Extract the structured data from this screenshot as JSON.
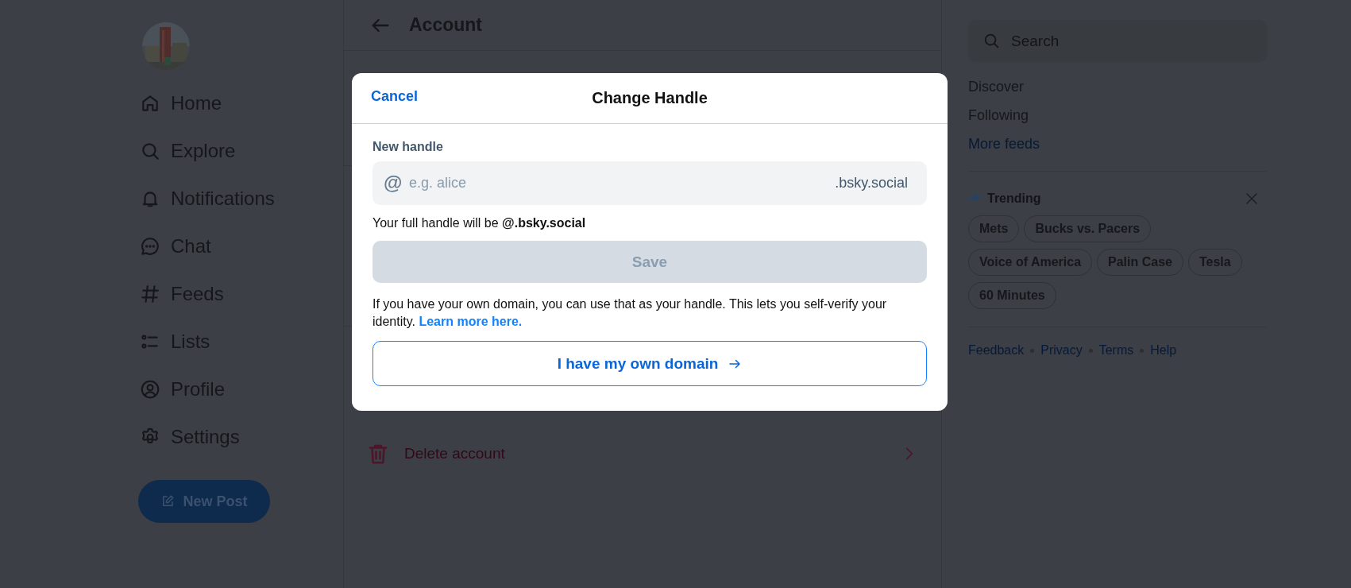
{
  "sidebar": {
    "nav": [
      {
        "label": "Home"
      },
      {
        "label": "Explore"
      },
      {
        "label": "Notifications"
      },
      {
        "label": "Chat"
      },
      {
        "label": "Feeds"
      },
      {
        "label": "Lists"
      },
      {
        "label": "Profile"
      },
      {
        "label": "Settings"
      }
    ],
    "new_post": "New Post"
  },
  "main": {
    "title": "Account",
    "rows": [
      {
        "label": "Delete account",
        "kind": "danger"
      }
    ]
  },
  "right": {
    "search": {
      "placeholder": "Search"
    },
    "feeds": [
      {
        "label": "Discover",
        "kind": "plain"
      },
      {
        "label": "Following",
        "kind": "plain"
      },
      {
        "label": "More feeds",
        "kind": "link"
      }
    ],
    "trending": {
      "title": "Trending",
      "topics": [
        "Mets",
        "Bucks vs. Pacers",
        "Voice of America",
        "Palin Case",
        "Tesla",
        "60 Minutes"
      ]
    },
    "footer": [
      "Feedback",
      "Privacy",
      "Terms",
      "Help"
    ]
  },
  "dialog": {
    "cancel": "Cancel",
    "title": "Change Handle",
    "field_label": "New handle",
    "prefix": "@",
    "placeholder": "e.g. alice",
    "suffix": ".bsky.social",
    "preview": "Your full handle will be **@.bsky.social**",
    "save": {
      "label": "Save",
      "disabled": true
    },
    "info": "If you have your own domain, you can use that as your handle. This lets you self-verify your identity.",
    "info_link": "Learn more here.",
    "own_domain": "I have my own domain"
  }
}
